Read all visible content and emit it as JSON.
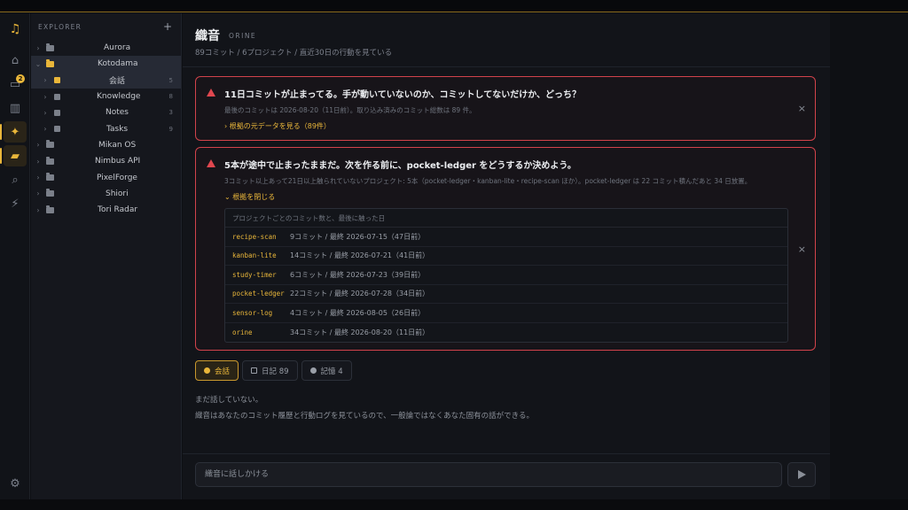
{
  "colors": {
    "accent": "#e9b63a",
    "alert": "#d2434b",
    "bg": "#121419",
    "sidebar": "#15171d"
  },
  "activity": {
    "logo": "music-note-icon",
    "items": [
      {
        "icon": "home-icon",
        "glyph": "⌂"
      },
      {
        "icon": "inbox-icon",
        "glyph": "▭",
        "badge": "2"
      },
      {
        "icon": "chart-icon",
        "glyph": "▥"
      },
      {
        "icon": "sparkle-icon",
        "glyph": "✦",
        "active": true
      },
      {
        "icon": "folder-icon",
        "glyph": "▰",
        "active": true
      },
      {
        "icon": "search-icon",
        "glyph": "⌕"
      },
      {
        "icon": "bolt-icon",
        "glyph": "⚡"
      }
    ],
    "settings": {
      "icon": "gear-icon",
      "glyph": "⚙"
    }
  },
  "explorer": {
    "title": "EXPLORER",
    "add": "+",
    "projects": [
      {
        "name": "Aurora",
        "open": false
      },
      {
        "name": "Kotodama",
        "open": true,
        "children": [
          {
            "name": "会話",
            "count": "5",
            "icon": "chat"
          },
          {
            "name": "Knowledge",
            "count": "8",
            "icon": "brain"
          },
          {
            "name": "Notes",
            "count": "3",
            "icon": "doc"
          },
          {
            "name": "Tasks",
            "count": "9",
            "icon": "task"
          }
        ]
      },
      {
        "name": "Mikan OS",
        "open": false
      },
      {
        "name": "Nimbus API",
        "open": false
      },
      {
        "name": "PixelForge",
        "open": false
      },
      {
        "name": "Shiori",
        "open": false
      },
      {
        "name": "Tori Radar",
        "open": false
      }
    ]
  },
  "header": {
    "title": "織音",
    "tag": "ORINE",
    "meta": "89コミット / 6プロジェクト / 直近30日の行動を見ている"
  },
  "alert1": {
    "title": "11日コミットが止まってる。手が動いていないのか、コミットしてないだけか、どっち？",
    "desc": "最後のコミットは 2026-08-20（11日前）。取り込み済みのコミット総数は 89 件。",
    "link": "根拠の元データを見る（89件）",
    "close": "×"
  },
  "alert2": {
    "title": "5本が途中で止まったままだ。次を作る前に、pocket-ledger をどうするか決めよう。",
    "desc": "3コミット以上あって21日以上触られていないプロジェクト: 5本（pocket-ledger・kanban-lite・recipe-scan ほか）。pocket-ledger は 22 コミット積んだあと 34 日放置。",
    "link": "根拠を閉じる",
    "close": "×",
    "table_header": "プロジェクトごとのコミット数と、最後に触った日",
    "rows": [
      {
        "project": "recipe-scan",
        "info": "9コミット / 最終 2026-07-15（47日前）"
      },
      {
        "project": "kanban-lite",
        "info": "14コミット / 最終 2026-07-21（41日前）"
      },
      {
        "project": "study-timer",
        "info": "6コミット / 最終 2026-07-23（39日前）"
      },
      {
        "project": "pocket-ledger",
        "info": "22コミット / 最終 2026-07-28（34日前）"
      },
      {
        "project": "sensor-log",
        "info": "4コミット / 最終 2026-08-05（26日前）"
      },
      {
        "project": "orine",
        "info": "34コミット / 最終 2026-08-20（11日前）"
      }
    ]
  },
  "tabs": [
    {
      "label": "会話",
      "active": true,
      "icon": "chat-icon"
    },
    {
      "label": "日記 89",
      "active": false,
      "icon": "pencil-icon"
    },
    {
      "label": "記憶 4",
      "active": false,
      "icon": "brain-icon"
    }
  ],
  "empty": {
    "line1": "まだ話していない。",
    "line2": "織音はあなたのコミット履歴と行動ログを見ているので、一般論ではなくあなた固有の話ができる。"
  },
  "input": {
    "placeholder": "織音に話しかける",
    "send_icon": "send-icon"
  }
}
